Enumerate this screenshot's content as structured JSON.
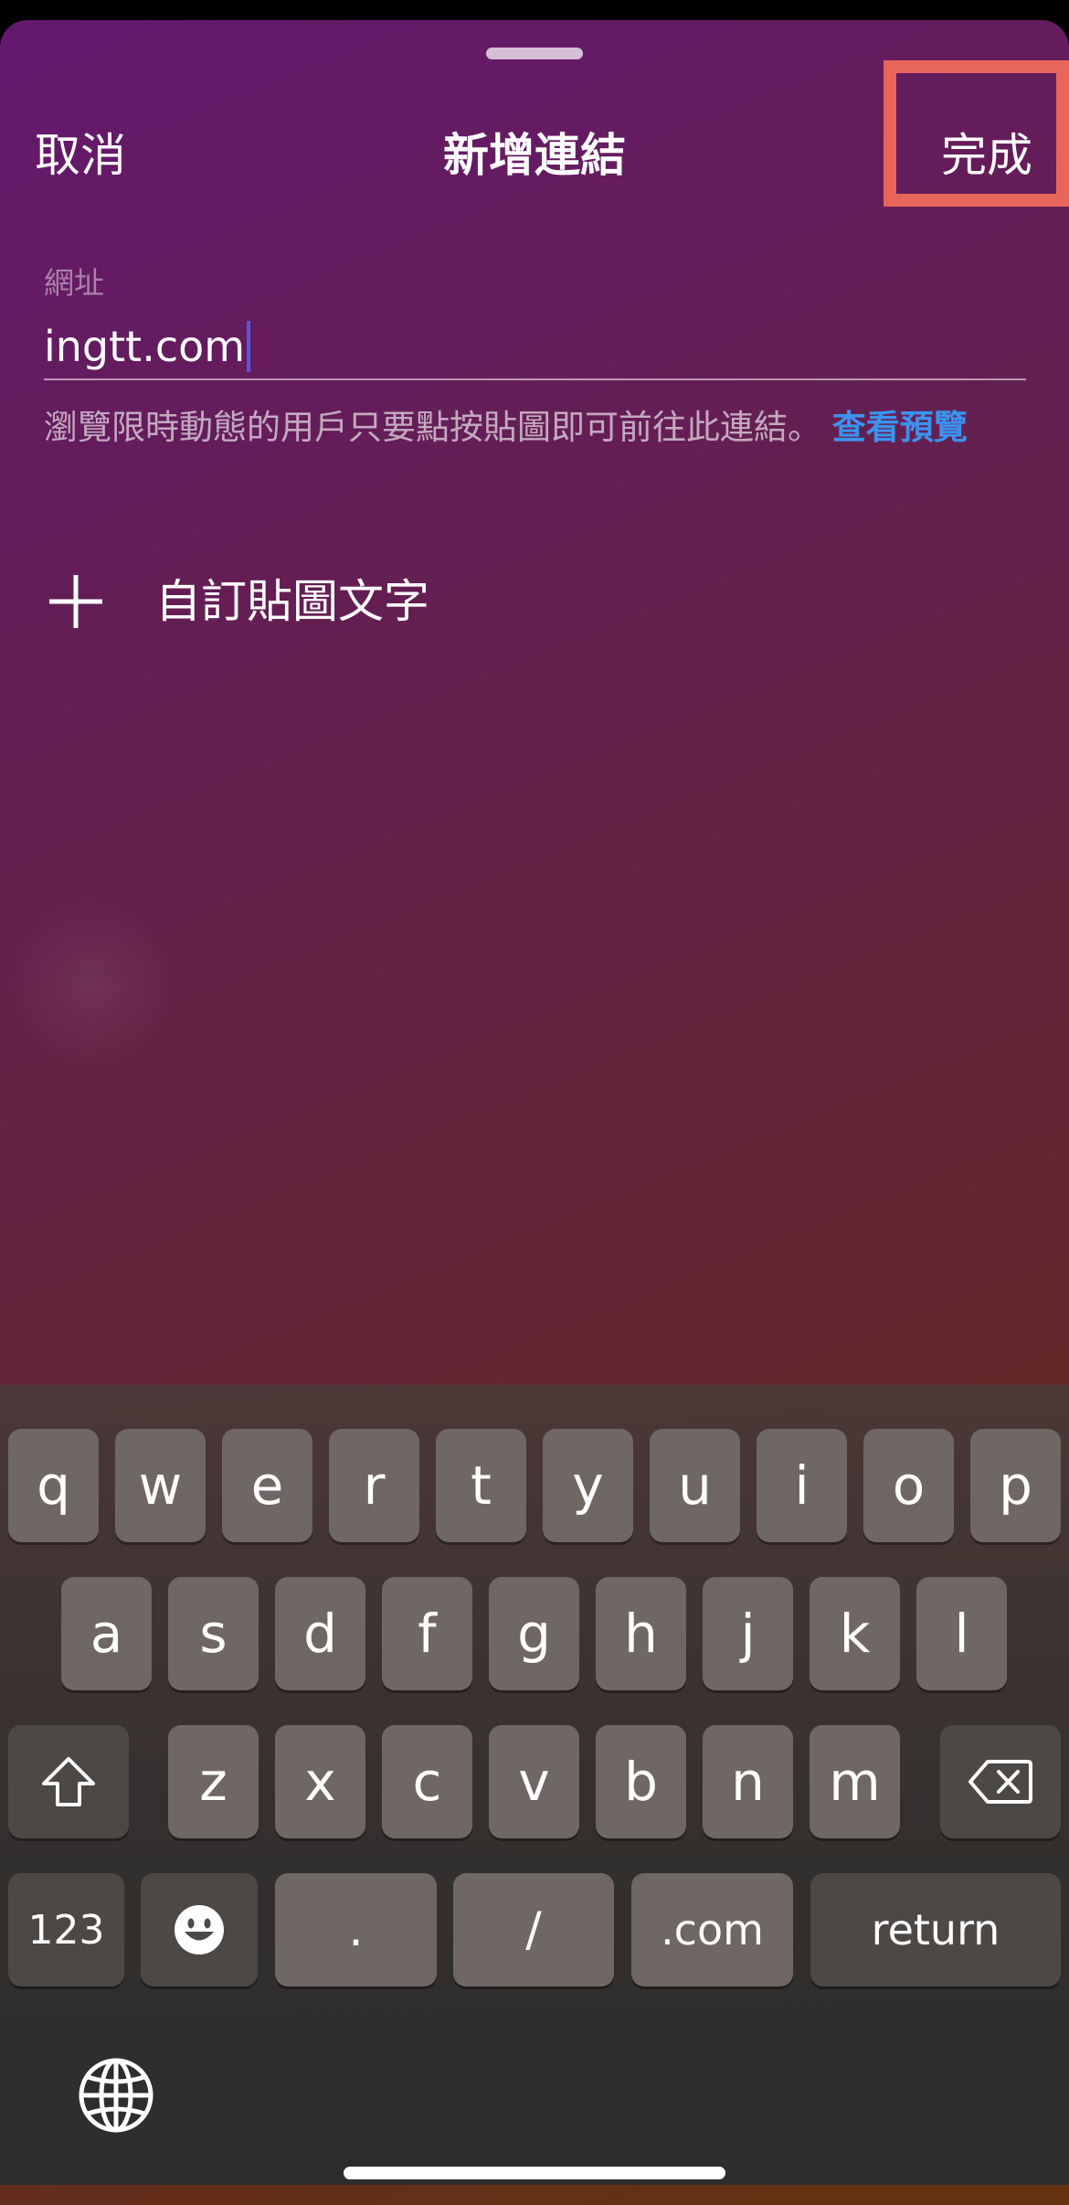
{
  "header": {
    "cancel_label": "取消",
    "title": "新增連結",
    "done_label": "完成"
  },
  "url_field": {
    "label": "網址",
    "value": "ingtt.com"
  },
  "helper": {
    "text": "瀏覽限時動態的用戶只要點按貼圖即可前往此連結。",
    "link_label": "查看預覽"
  },
  "custom_sticker_text": {
    "label": "自訂貼圖文字",
    "icon": "plus-icon"
  },
  "keyboard": {
    "rows": [
      [
        "q",
        "w",
        "e",
        "r",
        "t",
        "y",
        "u",
        "i",
        "o",
        "p"
      ],
      [
        "a",
        "s",
        "d",
        "f",
        "g",
        "h",
        "j",
        "k",
        "l"
      ],
      [
        "z",
        "x",
        "c",
        "v",
        "b",
        "n",
        "m"
      ]
    ],
    "shift_icon": "shift-icon",
    "delete_icon": "delete-icon",
    "numbers_label": "123",
    "emoji_icon": "emoji-icon",
    "period_label": ".",
    "slash_label": "/",
    "dotcom_label": ".com",
    "return_label": "return",
    "globe_icon": "globe-icon"
  },
  "colors": {
    "highlight_border": "#e8655a",
    "link": "#3b93f0",
    "caret": "#5a56d8"
  }
}
